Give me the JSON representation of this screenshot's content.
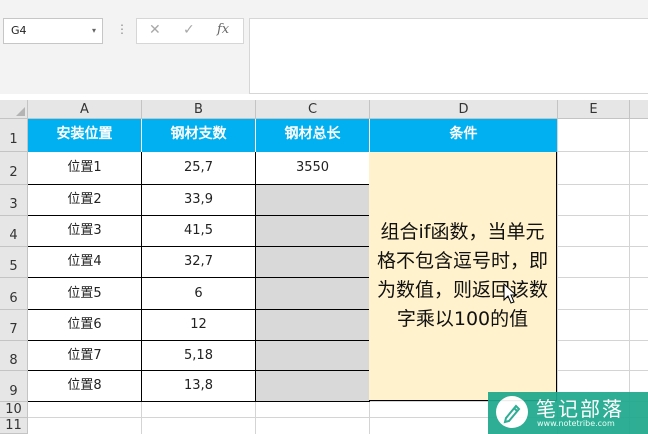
{
  "formula_bar": {
    "name_box": "G4",
    "name_dropdown": "▾",
    "separator": "⋮",
    "cancel_glyph": "✕",
    "enter_glyph": "✓",
    "fx_glyph": "fx",
    "formula_value": ""
  },
  "columns": [
    "A",
    "B",
    "C",
    "D",
    "E"
  ],
  "rows": [
    "1",
    "2",
    "3",
    "4",
    "5",
    "6",
    "7",
    "8",
    "9",
    "10",
    "11"
  ],
  "headers": {
    "a": "安装位置",
    "b": "钢材支数",
    "c": "钢材总长",
    "d": "条件"
  },
  "table_rows": [
    {
      "position": "位置1",
      "count": "25,7",
      "total": "3550"
    },
    {
      "position": "位置2",
      "count": "33,9",
      "total": ""
    },
    {
      "position": "位置3",
      "count": "41,5",
      "total": ""
    },
    {
      "position": "位置4",
      "count": "32,7",
      "total": ""
    },
    {
      "position": "位置5",
      "count": "6",
      "total": ""
    },
    {
      "position": "位置6",
      "count": "12",
      "total": ""
    },
    {
      "position": "位置7",
      "count": "5,18",
      "total": ""
    },
    {
      "position": "位置8",
      "count": "13,8",
      "total": ""
    }
  ],
  "condition_note": "组合if函数，当单元格不包含逗号时，即为数值，则返回该数字乘以100的值",
  "watermark": {
    "brand": "笔记部落",
    "url": "www.notetribe.com"
  },
  "colors": {
    "header_fill": "#00b0f0",
    "note_fill": "#fff2cc",
    "empty_total_fill": "#d9d9d9",
    "watermark_fill": "#1fa88c"
  }
}
